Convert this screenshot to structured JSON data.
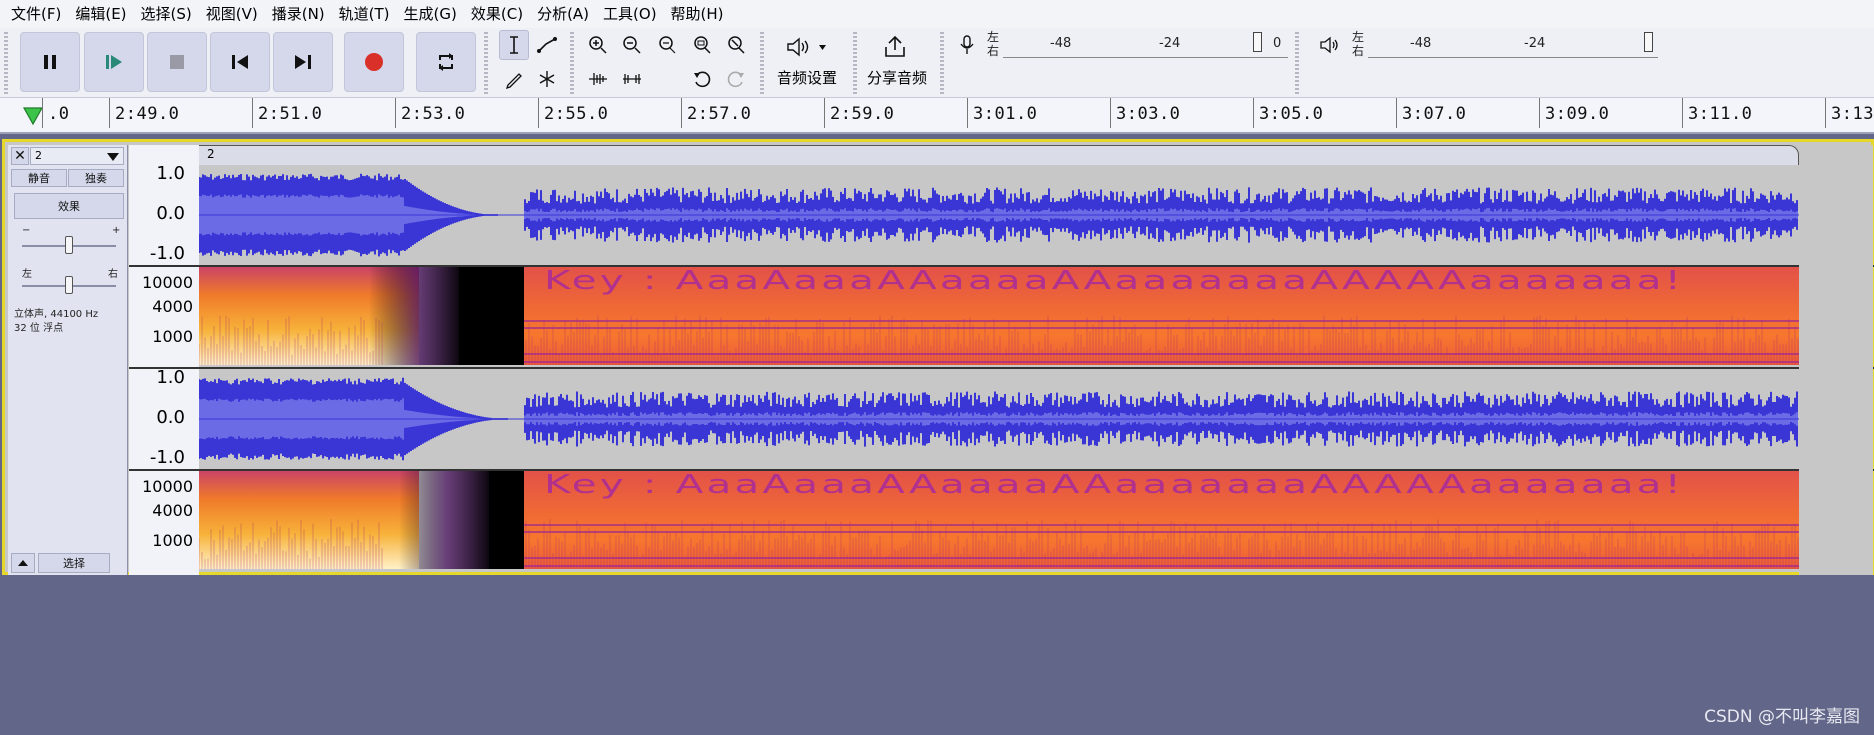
{
  "menu": [
    "文件(F)",
    "编辑(E)",
    "选择(S)",
    "视图(V)",
    "播录(N)",
    "轨道(T)",
    "生成(G)",
    "效果(C)",
    "分析(A)",
    "工具(O)",
    "帮助(H)"
  ],
  "toolbar": {
    "audio_setup_label": "音频设置",
    "share_audio_label": "分享音频",
    "record_meter": {
      "left": "左",
      "right": "右",
      "ticks": [
        "-48",
        "-24",
        "0"
      ]
    },
    "play_meter": {
      "left": "左",
      "right": "右",
      "ticks": [
        "-48",
        "-24"
      ]
    }
  },
  "ruler": {
    "ticks": [
      ".0",
      "2:49.0",
      "2:51.0",
      "2:53.0",
      "2:55.0",
      "2:57.0",
      "2:59.0",
      "3:01.0",
      "3:03.0",
      "3:05.0",
      "3:07.0",
      "3:09.0",
      "3:11.0",
      "3:13."
    ]
  },
  "track": {
    "name": "2",
    "clip_name": "2",
    "mute_label": "静音",
    "solo_label": "独奏",
    "effects_label": "效果",
    "gain_minus": "−",
    "gain_plus": "+",
    "pan_left": "左",
    "pan_right": "右",
    "info_line1": "立体声, 44100 Hz",
    "info_line2": "32 位 浮点",
    "select_label": "选择",
    "channels": [
      {
        "wave_scale": [
          "1.0",
          "0.0",
          "-1.0"
        ],
        "spec_scale": [
          "10000",
          "4000",
          "1000"
        ],
        "spectrogram_text": "Key : AaaAaaaAAaaaaAAaaaaaaaAAAAAaaaaaaa!"
      },
      {
        "wave_scale": [
          "1.0",
          "0.0",
          "-1.0"
        ],
        "spec_scale": [
          "10000",
          "4000",
          "1000"
        ],
        "spectrogram_text": "Key : AaaAaaaAAaaaaAAaaaaaaaAAAAAaaaaaaa!"
      }
    ]
  },
  "colors": {
    "waveform": "#3a36d6",
    "waveform_rms": "#6b6be6",
    "track_background": "#c7c7c7",
    "selection_border": "#e6d82a",
    "app_background": "#626688",
    "spectrogram_base": "#f06a34",
    "spectrogram_text": "#a82a9c"
  },
  "watermark": "CSDN @不叫李嘉图"
}
